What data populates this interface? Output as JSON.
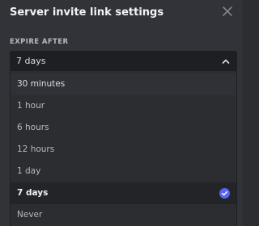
{
  "header": {
    "title": "Server invite link settings",
    "close_icon": "close-icon"
  },
  "expire": {
    "label": "EXPIRE AFTER",
    "selected_value": "7 days",
    "chevron_icon": "chevron-up-icon",
    "options": [
      {
        "label": "30 minutes",
        "state": "hover"
      },
      {
        "label": "1 hour",
        "state": ""
      },
      {
        "label": "6 hours",
        "state": ""
      },
      {
        "label": "12 hours",
        "state": ""
      },
      {
        "label": "1 day",
        "state": ""
      },
      {
        "label": "7 days",
        "state": "selected"
      },
      {
        "label": "Never",
        "state": ""
      }
    ],
    "check_icon": "check-circle-icon"
  },
  "colors": {
    "accent": "#5865f2",
    "background": "#313338",
    "input_background": "#1e1f22"
  }
}
